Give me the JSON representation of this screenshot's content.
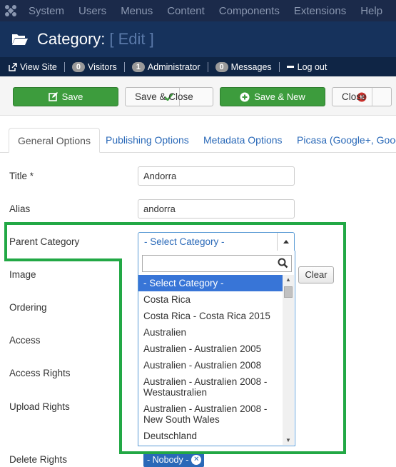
{
  "topmenu": {
    "logo_icon": "joomla-logo-icon",
    "items": [
      "System",
      "Users",
      "Menus",
      "Content",
      "Components",
      "Extensions",
      "Help"
    ]
  },
  "header": {
    "icon": "folder-open-icon",
    "title": "Category:",
    "subtitle": "[ Edit ]"
  },
  "status": {
    "view_site": "View Site",
    "visitors_count": "0",
    "visitors_label": "Visitors",
    "admin_count": "1",
    "admin_label": "Administrator",
    "messages_count": "0",
    "messages_label": "Messages",
    "logout": "Log out"
  },
  "toolbar": {
    "save": "Save",
    "save_close": "Save & Close",
    "save_new": "Save & New",
    "close": "Close"
  },
  "tabs": [
    "General Options",
    "Publishing Options",
    "Metadata Options",
    "Picasa (Google+, Googl"
  ],
  "form": {
    "title_label": "Title *",
    "title_value": "Andorra",
    "alias_label": "Alias",
    "alias_value": "andorra",
    "parent_label": "Parent Category",
    "parent_value": "- Select Category -",
    "image_label": "Image",
    "clear_label": "Clear",
    "ordering_label": "Ordering",
    "access_label": "Access",
    "access_rights_label": "Access Rights",
    "upload_rights_label": "Upload Rights",
    "delete_rights_label": "Delete Rights",
    "delete_rights_tag": "- Nobody -"
  },
  "dropdown": {
    "search_value": "",
    "options": [
      "- Select Category -",
      "Costa Rica",
      "Costa Rica - Costa Rica 2015",
      "Australien",
      "Australien - Australien 2005",
      "Australien - Australien 2008",
      "Australien - Australien 2008 - Westaustralien",
      "Australien - Australien 2008 - New South Wales",
      "Deutschland"
    ],
    "selected_index": 0
  },
  "colors": {
    "highlight": "#22a845",
    "green_button": "#3d9c3d",
    "link_blue": "#2a69b8",
    "selected_option": "#3875d7"
  }
}
